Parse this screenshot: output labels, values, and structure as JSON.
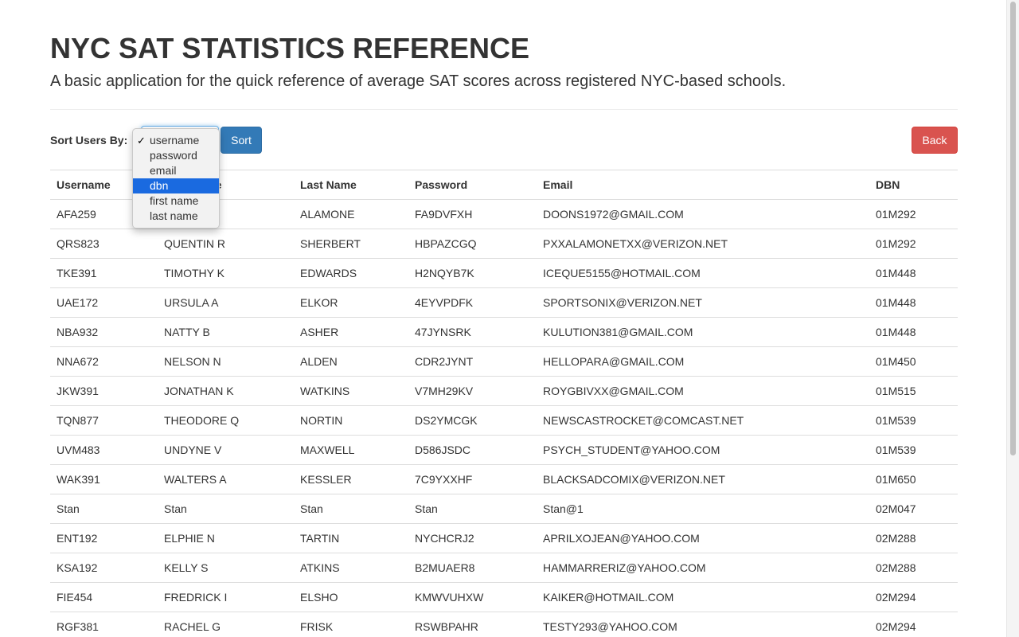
{
  "header": {
    "title": "NYC SAT STATISTICS REFERENCE",
    "subtitle": "A basic application for the quick reference of average SAT scores across registered NYC-based schools."
  },
  "controls": {
    "sort_label": "Sort Users By:",
    "sort_button": "Sort",
    "back_button": "Back",
    "select": {
      "selected": "username",
      "highlighted": "dbn",
      "options": [
        "username",
        "password",
        "email",
        "dbn",
        "first name",
        "last name"
      ]
    }
  },
  "table": {
    "columns": [
      "Username",
      "First Name",
      "Last Name",
      "Password",
      "Email",
      "DBN"
    ],
    "rows": [
      [
        "AFA259",
        "",
        "ALAMONE",
        "FA9DVFXH",
        "DOONS1972@GMAIL.COM",
        "01M292"
      ],
      [
        "QRS823",
        "QUENTIN R",
        "SHERBERT",
        "HBPAZCGQ",
        "PXXALAMONETXX@VERIZON.NET",
        "01M292"
      ],
      [
        "TKE391",
        "TIMOTHY K",
        "EDWARDS",
        "H2NQYB7K",
        "ICEQUE5155@HOTMAIL.COM",
        "01M448"
      ],
      [
        "UAE172",
        "URSULA A",
        "ELKOR",
        "4EYVPDFK",
        "SPORTSONIX@VERIZON.NET",
        "01M448"
      ],
      [
        "NBA932",
        "NATTY B",
        "ASHER",
        "47JYNSRK",
        "KULUTION381@GMAIL.COM",
        "01M448"
      ],
      [
        "NNA672",
        "NELSON N",
        "ALDEN",
        "CDR2JYNT",
        "HELLOPARA@GMAIL.COM",
        "01M450"
      ],
      [
        "JKW391",
        "JONATHAN K",
        "WATKINS",
        "V7MH29KV",
        "ROYGBIVXX@GMAIL.COM",
        "01M515"
      ],
      [
        "TQN877",
        "THEODORE Q",
        "NORTIN",
        "DS2YMCGK",
        "NEWSCASTROCKET@COMCAST.NET",
        "01M539"
      ],
      [
        "UVM483",
        "UNDYNE V",
        "MAXWELL",
        "D586JSDC",
        "PSYCH_STUDENT@YAHOO.COM",
        "01M539"
      ],
      [
        "WAK391",
        "WALTERS A",
        "KESSLER",
        "7C9YXXHF",
        "BLACKSADCOMIX@VERIZON.NET",
        "01M650"
      ],
      [
        "Stan",
        "Stan",
        "Stan",
        "Stan",
        "Stan@1",
        "02M047"
      ],
      [
        "ENT192",
        "ELPHIE N",
        "TARTIN",
        "NYCHCRJ2",
        "APRILXOJEAN@YAHOO.COM",
        "02M288"
      ],
      [
        "KSA192",
        "KELLY S",
        "ATKINS",
        "B2MUAER8",
        "HAMMARRERIZ@YAHOO.COM",
        "02M288"
      ],
      [
        "FIE454",
        "FREDRICK I",
        "ELSHO",
        "KMWVUHXW",
        "KAIKER@HOTMAIL.COM",
        "02M294"
      ],
      [
        "RGF381",
        "RACHEL G",
        "FRISK",
        "RSWBPAHR",
        "TESTY293@YAHOO.COM",
        "02M294"
      ]
    ]
  }
}
